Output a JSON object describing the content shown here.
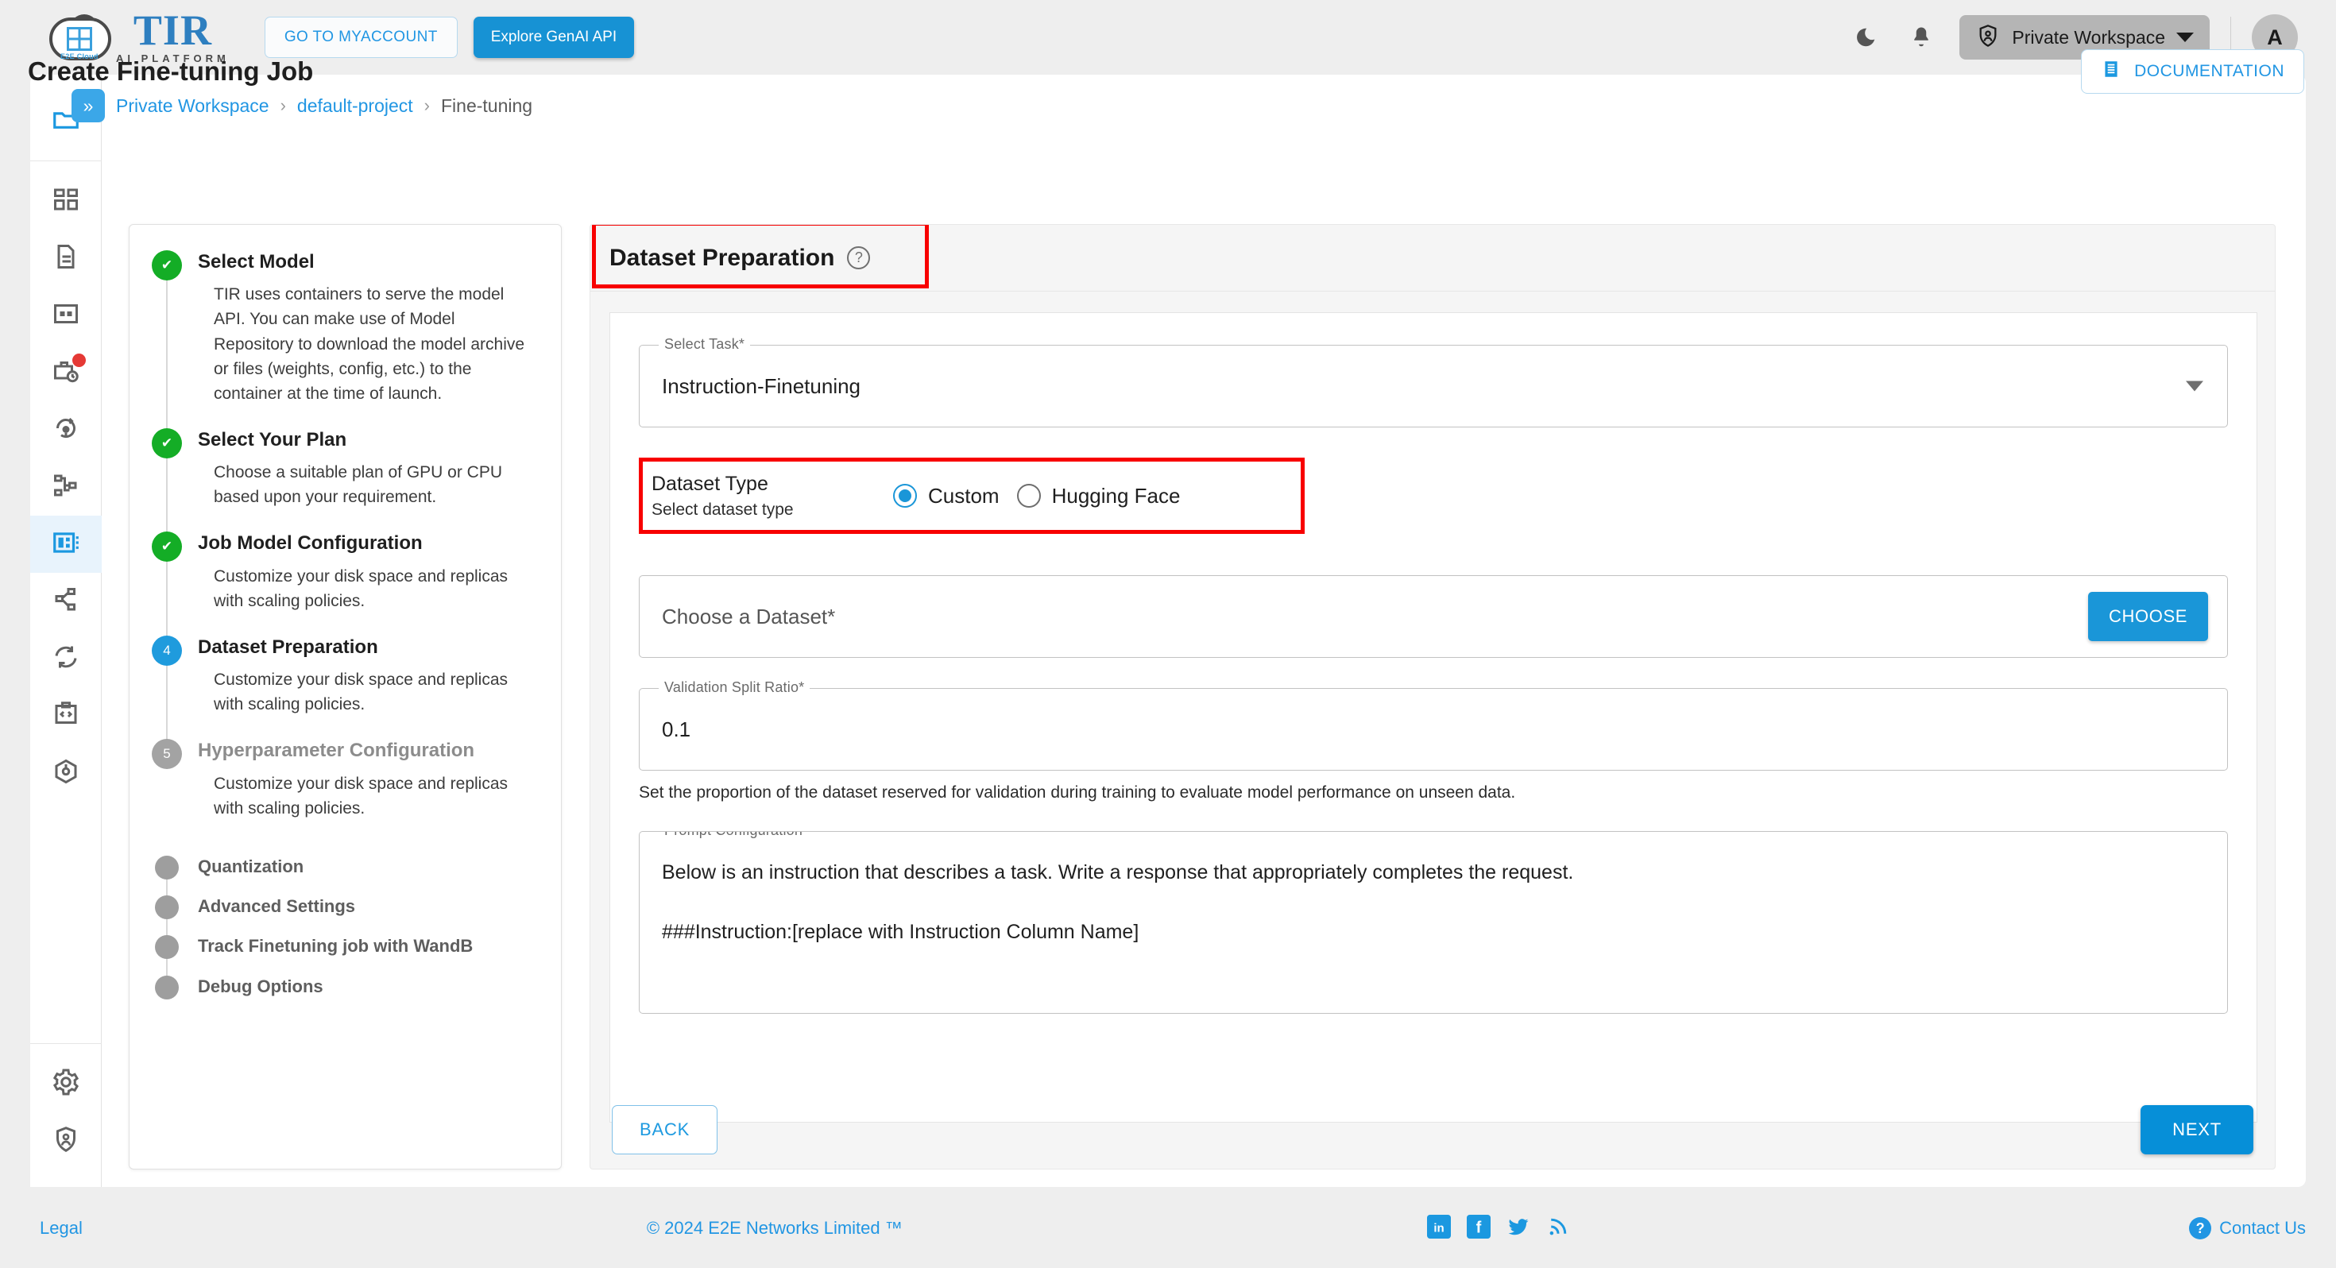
{
  "topbar": {
    "logo_title": "TIR",
    "logo_subtitle": "AI PLATFORM",
    "logo_badge": "E2E Cloud",
    "myaccount_button": "GO TO MYACCOUNT",
    "genai_button": "Explore GenAI API",
    "dark_mode_icon": "moon-icon",
    "notifications_icon": "bell-icon",
    "workspace_label": "Private Workspace",
    "workspace_icon": "shield-user-icon",
    "avatar_initial": "A"
  },
  "breadcrumb": {
    "toggle_icon": "chevron-double-right-icon",
    "items": [
      {
        "label": "Private Workspace",
        "current": false
      },
      {
        "label": "default-project",
        "current": false
      },
      {
        "label": "Fine-tuning",
        "current": true
      }
    ],
    "separator": "›"
  },
  "rail": {
    "items": [
      {
        "name": "folder-icon",
        "active": false,
        "accent": true
      },
      {
        "name": "dashboard-grid-icon",
        "active": false
      },
      {
        "name": "document-icon",
        "active": false
      },
      {
        "name": "table-grid-icon",
        "active": false
      },
      {
        "name": "briefcase-clock-icon",
        "active": false,
        "badge": true
      },
      {
        "name": "model-deploy-icon",
        "active": false
      },
      {
        "name": "pipeline-nodes-icon",
        "active": false
      },
      {
        "name": "finetuning-icon",
        "active": true
      },
      {
        "name": "share-nodes-icon",
        "active": false
      },
      {
        "name": "sync-icon",
        "active": false
      },
      {
        "name": "code-snippet-icon",
        "active": false
      },
      {
        "name": "package-cube-icon",
        "active": false
      },
      {
        "name": "settings-gear-icon",
        "active": false
      },
      {
        "name": "security-shield-icon",
        "active": false
      }
    ]
  },
  "page": {
    "title": "Create Fine-tuning Job",
    "documentation_button": "DOCUMENTATION",
    "documentation_icon": "book-icon"
  },
  "stepper": {
    "steps": [
      {
        "number": "1",
        "state": "done",
        "title": "Select Model",
        "description": "TIR uses containers to serve the model API. You can make use of Model Repository to download the model archive or files (weights, config, etc.) to the container at the time of launch."
      },
      {
        "number": "2",
        "state": "done",
        "title": "Select Your Plan",
        "description": "Choose a suitable plan of GPU or CPU based upon your requirement."
      },
      {
        "number": "3",
        "state": "done",
        "title": "Job Model Configuration",
        "description": "Customize your disk space and replicas with scaling policies."
      },
      {
        "number": "4",
        "state": "current",
        "title": "Dataset Preparation",
        "description": "Customize your disk space and replicas with scaling policies."
      },
      {
        "number": "5",
        "state": "pending",
        "title": "Hyperparameter Configuration",
        "description": "Customize your disk space and replicas with scaling policies."
      }
    ],
    "substeps": [
      {
        "title": "Quantization"
      },
      {
        "title": "Advanced Settings"
      },
      {
        "title": "Track Finetuning job with WandB"
      },
      {
        "title": "Debug Options"
      }
    ]
  },
  "panel": {
    "title": "Dataset Preparation",
    "help_icon": "question-mark-icon",
    "select_task": {
      "label": "Select Task*",
      "value": "Instruction-Finetuning",
      "caret_icon": "chevron-down-icon"
    },
    "dataset_type": {
      "title": "Dataset Type",
      "subtitle": "Select dataset type",
      "options": [
        {
          "label": "Custom",
          "selected": true
        },
        {
          "label": "Hugging Face",
          "selected": false
        }
      ]
    },
    "choose_dataset": {
      "label": "Choose a Dataset*",
      "button": "CHOOSE"
    },
    "validation_split": {
      "label": "Validation Split Ratio*",
      "value": "0.1",
      "helper": "Set the proportion of the dataset reserved for validation during training to evaluate model performance on unseen data."
    },
    "prompt_config": {
      "label": "Prompt Configuration*",
      "line1": "Below is an instruction that describes a task. Write a response that appropriately completes the request.",
      "line2": "###Instruction:[replace with Instruction Column Name]"
    }
  },
  "actions": {
    "back_button": "BACK",
    "next_button": "NEXT"
  },
  "footer": {
    "legal": "Legal",
    "copyright": "© 2024 E2E Networks Limited ™",
    "social": [
      {
        "name": "linkedin-icon",
        "glyph": "in"
      },
      {
        "name": "facebook-icon",
        "glyph": "f"
      },
      {
        "name": "twitter-icon",
        "glyph": "t"
      },
      {
        "name": "rss-icon",
        "glyph": "r"
      }
    ],
    "contact": "Contact Us"
  },
  "colors": {
    "accent_blue": "#1a96d8",
    "link_blue": "#2196e3",
    "done_green": "#14ad26",
    "annotation_red": "#f80000",
    "pending_grey": "#a3a3a3"
  }
}
